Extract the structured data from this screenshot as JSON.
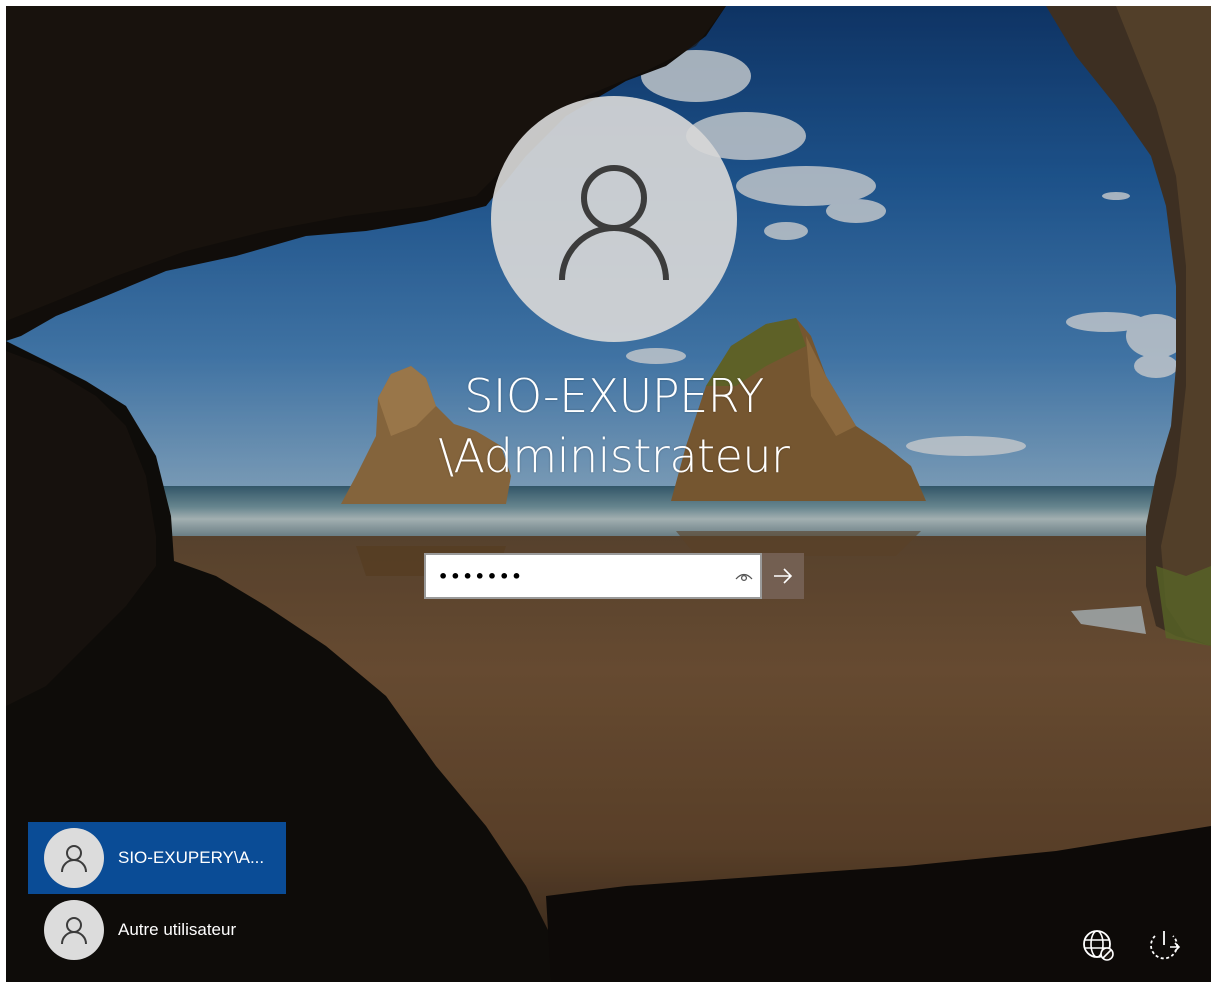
{
  "login": {
    "account_name": "SIO-EXUPERY\\Administrateur",
    "account_name_line1": "SIO-EXUPERY",
    "account_name_line2": "\\Administrateur",
    "password_value": "•••••••",
    "reveal_icon": "eye-icon",
    "submit_icon": "arrow-right-icon"
  },
  "user_list": [
    {
      "label": "SIO-EXUPERY\\A...",
      "icon": "user-icon",
      "selected": true
    },
    {
      "label": "Autre utilisateur",
      "icon": "user-icon",
      "selected": false
    }
  ],
  "corner_icons": [
    "network-icon",
    "power-icon"
  ],
  "colors": {
    "selected_user_bg": "#0a4c96",
    "submit_button_bg": "#786458",
    "avatar_bg": "#d7d7d7"
  }
}
